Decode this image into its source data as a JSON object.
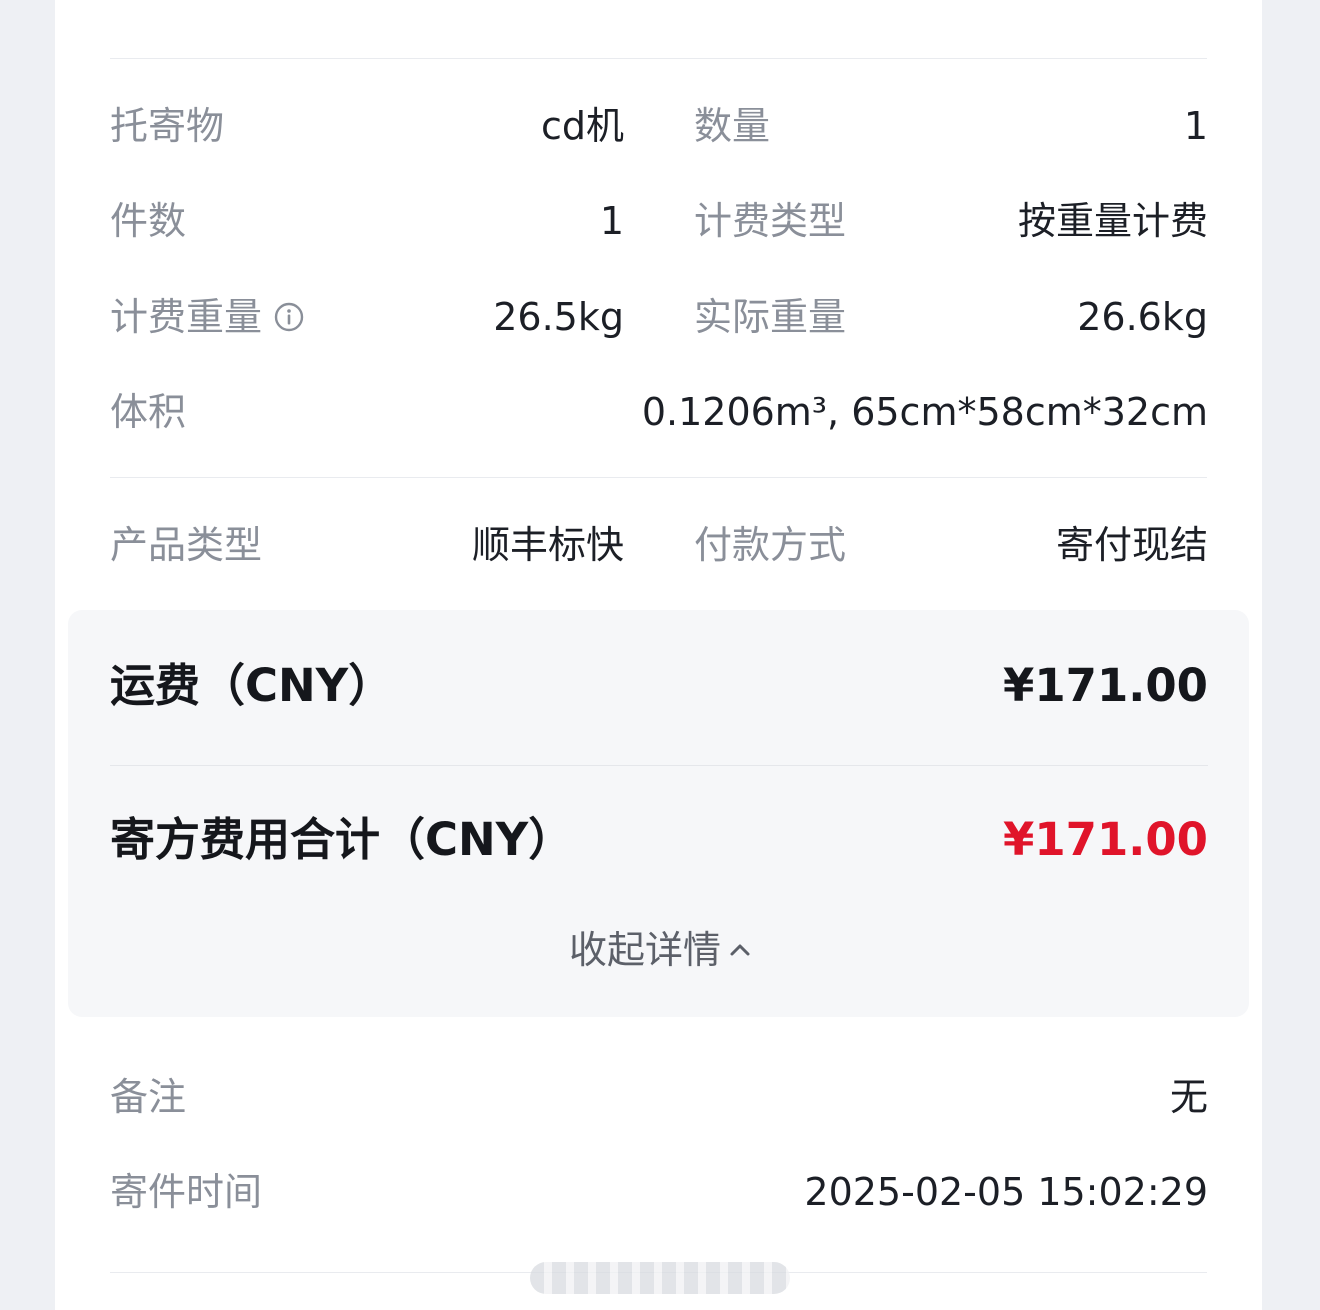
{
  "cargo": {
    "consignment_label": "托寄物",
    "consignment_value": "cd机",
    "quantity_label": "数量",
    "quantity_value": "1",
    "pieces_label": "件数",
    "pieces_value": "1",
    "billing_type_label": "计费类型",
    "billing_type_value": "按重量计费",
    "billed_weight_label": "计费重量",
    "billed_weight_value": "26.5kg",
    "actual_weight_label": "实际重量",
    "actual_weight_value": "26.6kg",
    "volume_label": "体积",
    "volume_value": "0.1206m³, 65cm*58cm*32cm"
  },
  "service": {
    "product_type_label": "产品类型",
    "product_type_value": "顺丰标快",
    "payment_label": "付款方式",
    "payment_value": "寄付现结"
  },
  "fees": {
    "freight_label": "运费（CNY）",
    "freight_value": "¥171.00",
    "total_label": "寄方费用合计（CNY）",
    "total_value": "¥171.00",
    "collapse_label": "收起详情",
    "total_color": "#e0142a"
  },
  "extra": {
    "remark_label": "备注",
    "remark_value": "无",
    "send_time_label": "寄件时间",
    "send_time_value": "2025-02-05 15:02:29"
  }
}
